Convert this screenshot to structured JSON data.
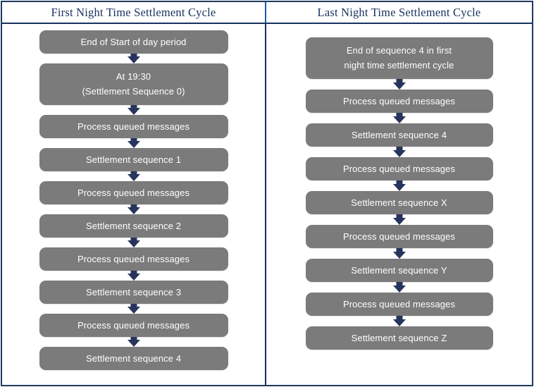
{
  "colors": {
    "table_border": "#1f3864",
    "header_text": "#17325e",
    "header_divider": "#1b57b5",
    "node_fill": "#7b7b7b",
    "node_text": "#ffffff",
    "arrow": "#27345c",
    "background": "#ffffff"
  },
  "columns": [
    {
      "id": "first-night-time-settlement-cycle",
      "header": "First Night Time Settlement Cycle",
      "nodes": [
        {
          "lines": [
            "End of Start of day period"
          ]
        },
        {
          "lines": [
            "At 19:30",
            "(Settlement Sequence 0)"
          ]
        },
        {
          "lines": [
            "Process queued messages"
          ]
        },
        {
          "lines": [
            "Settlement sequence 1"
          ]
        },
        {
          "lines": [
            "Process queued messages"
          ]
        },
        {
          "lines": [
            "Settlement sequence 2"
          ]
        },
        {
          "lines": [
            "Process queued messages"
          ]
        },
        {
          "lines": [
            "Settlement sequence 3"
          ]
        },
        {
          "lines": [
            "Process queued messages"
          ]
        },
        {
          "lines": [
            "Settlement sequence 4"
          ]
        }
      ]
    },
    {
      "id": "last-night-time-settlement-cycle",
      "header": "Last Night Time Settlement Cycle",
      "nodes": [
        {
          "lines": [
            "End of sequence 4 in first",
            "night time settlement cycle"
          ]
        },
        {
          "lines": [
            "Process queued messages"
          ]
        },
        {
          "lines": [
            "Settlement sequence 4"
          ]
        },
        {
          "lines": [
            "Process queued messages"
          ]
        },
        {
          "lines": [
            "Settlement sequence X"
          ]
        },
        {
          "lines": [
            "Process queued messages"
          ]
        },
        {
          "lines": [
            "Settlement sequence Y"
          ]
        },
        {
          "lines": [
            "Process queued messages"
          ]
        },
        {
          "lines": [
            "Settlement sequence Z"
          ]
        }
      ]
    }
  ]
}
